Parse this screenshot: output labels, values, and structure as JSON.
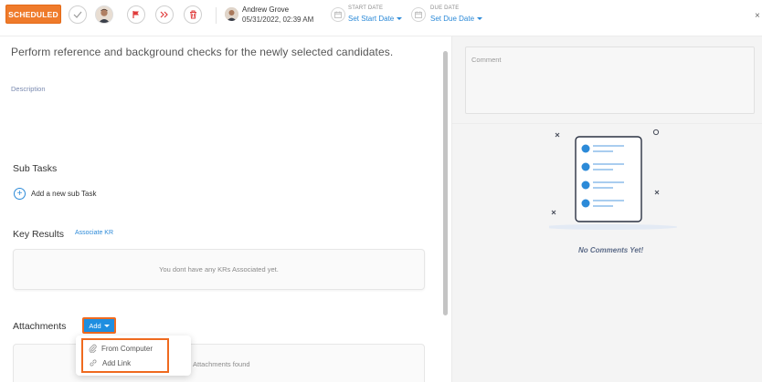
{
  "colors": {
    "accent_orange": "#ef7b2b",
    "link_blue": "#2c8ad8",
    "button_blue": "#1f8ee0",
    "highlight": "#ef6a1f"
  },
  "toolbar": {
    "status_label": "SCHEDULED",
    "owner_name": "Andrew Grove",
    "owner_datetime": "05/31/2022, 02:39 AM",
    "start_date_caption": "START DATE",
    "start_date_value": "Set Start Date",
    "due_date_caption": "DUE DATE",
    "due_date_value": "Set Due Date",
    "close_glyph": "×",
    "icons": [
      "check-icon",
      "avatar",
      "flag-icon",
      "forward-icon",
      "trash-icon",
      "calendar-icon",
      "close-icon"
    ]
  },
  "task": {
    "title": "Perform reference and background checks for the newly selected candidates.",
    "description_label": "Description"
  },
  "subtasks": {
    "heading": "Sub Tasks",
    "add_label": "Add a new sub Task",
    "plus_glyph": "+"
  },
  "key_results": {
    "heading": "Key Results",
    "associate_link": "Associate KR",
    "empty_text": "You dont have any KRs Associated yet."
  },
  "attachments": {
    "heading": "Attachments",
    "add_button": "Add",
    "empty_text": "Attachments found",
    "menu": {
      "from_computer": "From Computer",
      "add_link": "Add Link"
    }
  },
  "comments": {
    "placeholder": "Comment",
    "empty_text": "No Comments Yet!"
  }
}
